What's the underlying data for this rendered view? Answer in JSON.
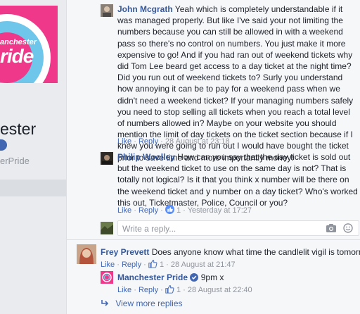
{
  "sidebar": {
    "logo_small": "anchester",
    "logo_big": "ride",
    "page_name": "ester",
    "page_handle": "erPride"
  },
  "comments": [
    {
      "author": "John Mcgrath",
      "text": "Yeah which is completely understandable if it was managed properly. But like I've said your not limiting the numbers because you can still be allowed in with a weekend pass so there's no control on numbers. You just make it more expensive to go! And if you had ran out of weekend tickets why did Tom Lee beard get access to a day ticket at the night time? Did you run out of weekend tickets to? Surly you understand how annoying it can be to pay for a weekend pass when we didn't need a weekend ticket? If your managing numbers safely you need to stop selling all tickets when you reach a total level of numbers allowed in? Maybe on your website you should mention the limit of day tickets on the ticket section because if I knew you were going to run out I would have bought the ticket prior to save time and more importantly money!",
      "like": "Like",
      "reply": "Reply",
      "time": "28 August at 23:18"
    },
    {
      "author": "Philip Woolley",
      "text": "How can you say that the day ticket is sold out but the weekend ticket to use on the same day is not? That is totally not logical? Is it that you think x number will be there on the weekend ticket and y number on a day ticket? Who's worked this out, Ticketmaster, Police, Council or you?",
      "like": "Like",
      "reply": "Reply",
      "likes_count": "1",
      "time": "Yesterday at 17:27"
    }
  ],
  "reply_box": {
    "placeholder": "Write a reply..."
  },
  "thread": {
    "author": "Frey Prevett",
    "text": "Does anyone know what time the candlelit vigil is tomorrow?",
    "like": "Like",
    "reply": "Reply",
    "likes_count": "1",
    "time": "28 August at 21:47"
  },
  "page_reply": {
    "author": "Manchester Pride",
    "text": "9pm x",
    "like": "Like",
    "reply": "Reply",
    "likes_count": "1",
    "time": "28 August at 22:40"
  },
  "view_more": "View more replies",
  "icons": {
    "like": "like-thumb-icon",
    "camera": "camera-icon",
    "emoji": "smile-icon",
    "verified": "verified-badge-icon",
    "reply_arrow": "reply-arrow-icon"
  },
  "colors": {
    "link": "#365899",
    "brand_pink": "#f0388a",
    "brand_blue": "#6ec6ea"
  }
}
